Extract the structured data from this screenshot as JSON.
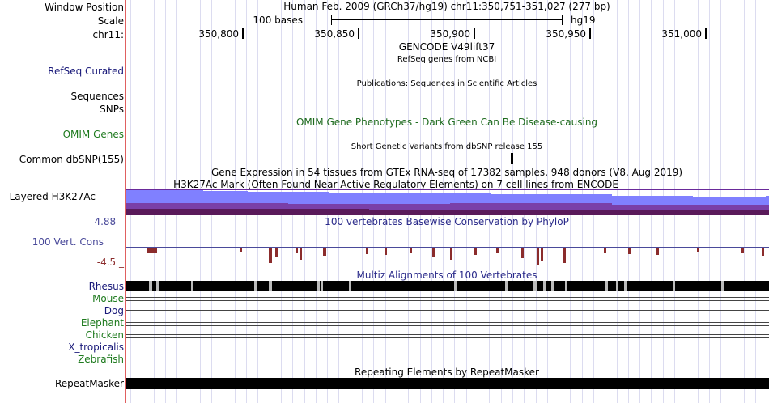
{
  "header": {
    "window_position_label": "Window Position",
    "scale_label": "Scale",
    "chr_label": "chr11:",
    "assembly_title": "Human Feb. 2009 (GRCh37/hg19)   chr11:350,751-351,027 (277 bp)",
    "scale_text": "100 bases",
    "scale_db": "hg19",
    "ticks": [
      "350,800",
      "350,850",
      "350,900",
      "350,950",
      "351,000"
    ]
  },
  "tracks": {
    "gencode_title": "GENCODE V49lift37",
    "refseq_label": "RefSeq Curated",
    "refseq_title": "RefSeq genes from NCBI",
    "pubs_title": "Publications: Sequences in Scientific Articles",
    "sequences_label": "Sequences",
    "snps_label": "SNPs",
    "omim_label": "OMIM Genes",
    "omim_title": "OMIM Gene Phenotypes - Dark Green Can Be Disease-causing",
    "dbsnp_title": "Short Genetic Variants from dbSNP release 155",
    "dbsnp_label": "Common dbSNP(155)",
    "gtex_title": "Gene Expression in 54 tissues from GTEx RNA-seq of 17382 samples, 948 donors (V8, Aug 2019)",
    "h3k27ac_title": "H3K27Ac Mark (Often Found Near Active Regulatory Elements) on 7 cell lines from ENCODE",
    "h3k27ac_label": "Layered H3K27Ac",
    "cons_max": "4.88 _",
    "cons_title": "100 vertebrates Basewise Conservation by PhyloP",
    "cons_label": "100 Vert. Cons",
    "cons_min": "-4.5 _",
    "multiz_title": "Multiz Alignments of 100 Vertebrates",
    "species": [
      "Rhesus",
      "Mouse",
      "Dog",
      "Elephant",
      "Chicken",
      "X_tropicalis",
      "Zebrafish"
    ],
    "rmsk_title": "Repeating Elements by RepeatMasker",
    "rmsk_label": "RepeatMasker"
  },
  "colors": {
    "blue_label": "#1a1a7a",
    "green_label": "#1e7a1e",
    "h3k27ac_light": "#8080ff",
    "h3k27ac_mid": "#7a3fa8",
    "h3k27ac_dark": "#5a1a5a",
    "cons_neg": "#8b2c2c",
    "cons_base": "#4a4a9a"
  }
}
